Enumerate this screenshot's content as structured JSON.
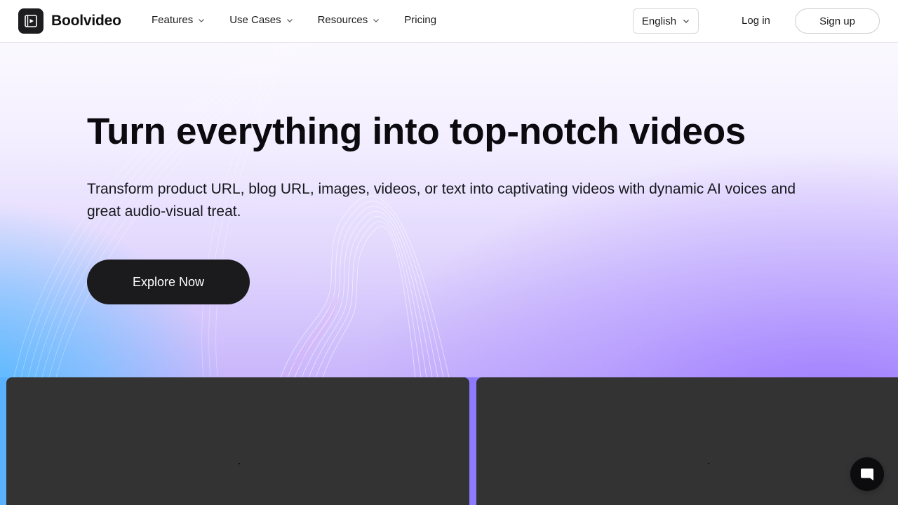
{
  "brand": {
    "name": "Boolvideo"
  },
  "nav": {
    "items": [
      {
        "label": "Features"
      },
      {
        "label": "Use Cases"
      },
      {
        "label": "Resources"
      },
      {
        "label": "Pricing"
      }
    ]
  },
  "header": {
    "language": "English",
    "login_label": "Log in",
    "signup_label": "Sign up"
  },
  "hero": {
    "title": "Turn everything into top-notch videos",
    "subtitle": "Transform product URL, blog URL, images, videos, or text into captivating videos with dynamic AI voices and great audio-visual treat.",
    "cta_label": "Explore Now"
  },
  "colors": {
    "primary_button": "#1b1b1d",
    "hero_gradient_left": "#46b9ff",
    "hero_gradient_right": "#946eff",
    "card_bg": "#333334"
  },
  "icons": {
    "logo": "video-play-icon",
    "dropdown": "chevron-down-icon",
    "chat": "chat-bubble-icon"
  }
}
